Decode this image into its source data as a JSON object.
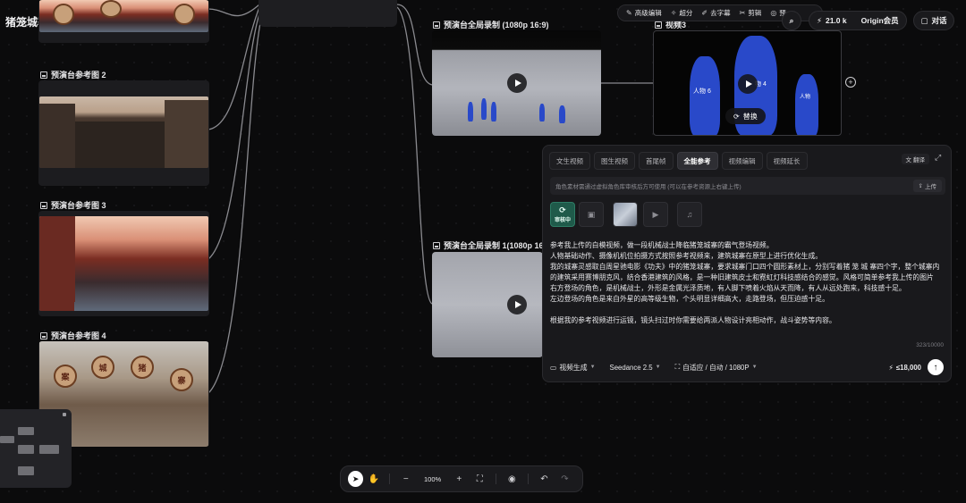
{
  "project": {
    "title": "猪笼城寨"
  },
  "ref_cards": [
    {
      "label": "预演台参考图 2"
    },
    {
      "label": "预演台参考图 3"
    },
    {
      "label": "预演台参考图 4"
    }
  ],
  "sign_chars": [
    "案",
    "城",
    "猪",
    "寨"
  ],
  "video_cards": [
    {
      "label": "预演台全局录制 (1080p 16:9)"
    },
    {
      "label": "预演台全局录制 1(1080p 16:9"
    },
    {
      "label": "视频3",
      "figure_labels": [
        "人物 6",
        "物 4",
        "人物"
      ],
      "replace_label": "替换"
    }
  ],
  "toolbar": {
    "items": [
      {
        "icon": "pen-icon",
        "label": "高级编辑"
      },
      {
        "icon": "sparkle-icon",
        "label": "超分"
      },
      {
        "icon": "subtitle-icon",
        "label": "去字幕"
      },
      {
        "icon": "scissors-icon",
        "label": "剪辑"
      },
      {
        "icon": "eye-icon",
        "label": "预"
      }
    ]
  },
  "top_right": {
    "credits": "21.0 k",
    "member": "Origin会员",
    "chat": "对话"
  },
  "panel": {
    "tabs": [
      "文生视频",
      "图生视频",
      "首尾帧",
      "全能参考",
      "视频编辑",
      "视频延长"
    ],
    "active_tab": "全能参考",
    "translate": "翻译",
    "notice": "角色素材需通过虚拟角色库审核后方可使用 (可以在参考资源上右键上传)",
    "upload": "上传",
    "review_label": "审核中",
    "prompt_lines": [
      "参考我上传的白模视频，做一段机械战士降临猪笼城寨的霸气登场视频。",
      "人物基础动作、摄像机机位拍摄方式按照参考视频来，建筑城寨在原型上进行优化生成。",
      "我的城寨灵感取自周星驰电影《功夫》中的猪笼城寨，要求城寨门口四个圆形素材上，分别写着猪 笼 城 寨四个字，整个城寨内的建筑采用赛博朋克风，结合香港建筑的风格，是一种旧建筑皮士和霓虹灯科技感结合的感觉。风格可简单参考我上传的图片",
      "右方登场的角色，是机械战士，外形是金属光泽质地，有人脚下喷着火焰从天而降，有人从远处跑来，科技感十足。",
      "左边登场的角色是来自外星的高等级生物，个头明显详细高大，走路登场，但压迫感十足。",
      "",
      "根据我的参考视频进行运镜，镜头扫过时你需要给两派人物设计亮相动作，战斗姿势等内容。"
    ],
    "counter": "323/10000",
    "mode": "视频生成",
    "model": "Seedance 2.5",
    "settings": "自适应 / 自动 / 1080P",
    "cost": "≤18,000"
  },
  "zoom": {
    "value": "100%"
  }
}
